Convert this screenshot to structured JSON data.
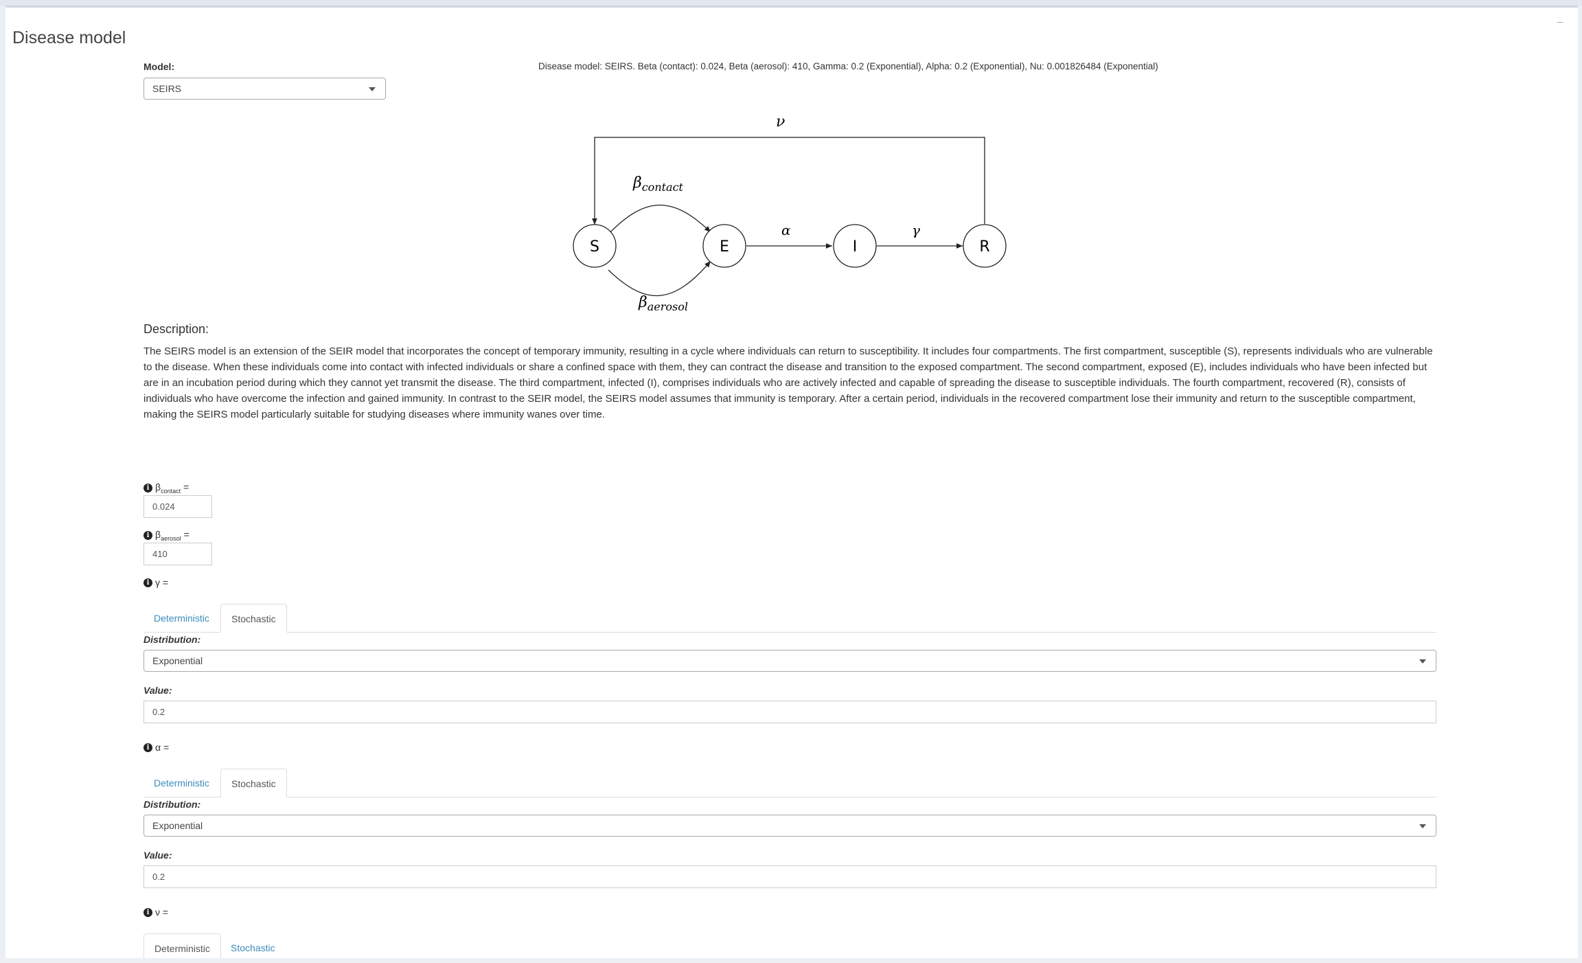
{
  "box": {
    "title": "Disease model",
    "collapse_label": "–"
  },
  "model": {
    "label": "Model:",
    "value": "SEIRS"
  },
  "summary": "Disease model: SEIRS. Beta (contact): 0.024, Beta (aerosol): 410, Gamma: 0.2 (Exponential), Alpha: 0.2 (Exponential), Nu: 0.001826484 (Exponential)",
  "diagram": {
    "nodes": [
      "S",
      "E",
      "I",
      "R"
    ],
    "nu": "ν",
    "beta": "β",
    "beta_contact_sub": "contact",
    "beta_aerosol_sub": "aerosol",
    "alpha": "α",
    "gamma": "γ"
  },
  "description": {
    "heading": "Description:",
    "text": "The SEIRS model is an extension of the SEIR model that incorporates the concept of temporary immunity, resulting in a cycle where individuals can return to susceptibility. It includes four compartments. The first compartment, susceptible (S), represents individuals who are vulnerable to the disease. When these individuals come into contact with infected individuals or share a confined space with them, they can contract the disease and transition to the exposed compartment. The second compartment, exposed (E), includes individuals who have been infected but are in an incubation period during which they cannot yet transmit the disease. The third compartment, infected (I), comprises individuals who are actively infected and capable of spreading the disease to susceptible individuals. The fourth compartment, recovered (R), consists of individuals who have overcome the infection and gained immunity. In contrast to the SEIR model, the SEIRS model assumes that immunity is temporary. After a certain period, individuals in the recovered compartment lose their immunity and return to the susceptible compartment, making the SEIRS model particularly suitable for studying diseases where immunity wanes over time."
  },
  "info_glyph": "i",
  "params": {
    "beta_contact": {
      "symbol": "β",
      "sub": "contact",
      "eq": " =",
      "value": "0.024"
    },
    "beta_aerosol": {
      "symbol": "β",
      "sub": "aerosol",
      "eq": " =",
      "value": "410"
    },
    "gamma": {
      "label": "γ =",
      "tabs": [
        "Deterministic",
        "Stochastic"
      ],
      "distribution_label": "Distribution:",
      "distribution": "Exponential",
      "value_label": "Value:",
      "value": "0.2"
    },
    "alpha": {
      "label": "α =",
      "tabs": [
        "Deterministic",
        "Stochastic"
      ],
      "distribution_label": "Distribution:",
      "distribution": "Exponential",
      "value_label": "Value:",
      "value": "0.2"
    },
    "nu": {
      "label": "ν =",
      "tabs": [
        "Deterministic",
        "Stochastic"
      ]
    }
  },
  "colors": {
    "link": "#3c8dbc",
    "background": "#ecf0f5"
  }
}
